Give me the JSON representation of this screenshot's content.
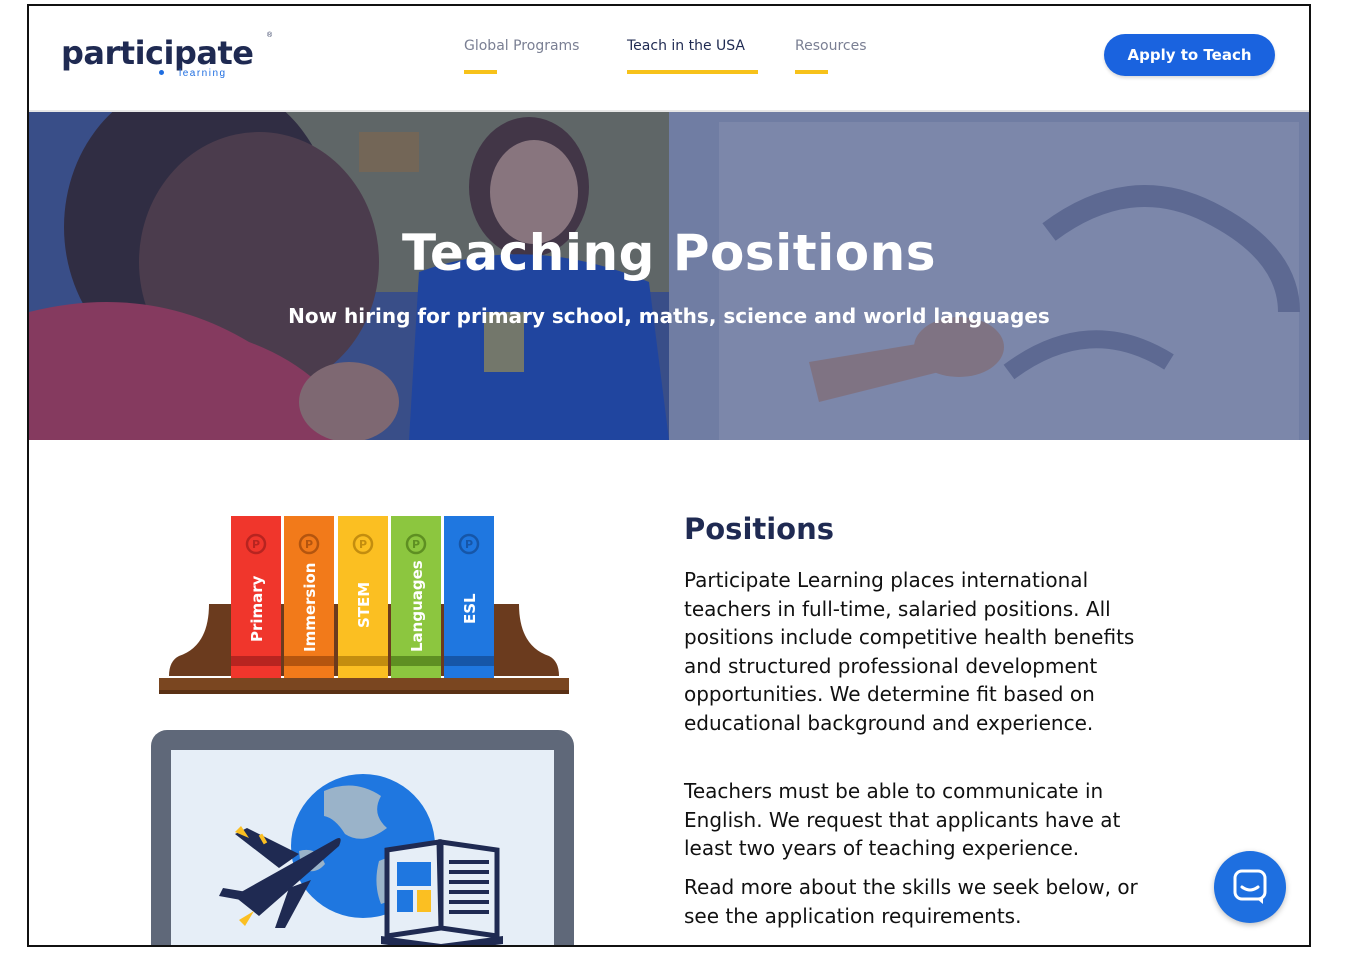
{
  "brand": {
    "name": "participate",
    "tagline": "learning",
    "colors": {
      "navy": "#1f2a52",
      "blue": "#1a63df",
      "accent_yellow": "#f7c21a"
    }
  },
  "nav": {
    "items": [
      {
        "label": "Global Programs",
        "active": false
      },
      {
        "label": "Teach in the USA",
        "active": true
      },
      {
        "label": "Resources",
        "active": false
      }
    ],
    "cta_label": "Apply to Teach"
  },
  "hero": {
    "title": "Teaching Positions",
    "subtitle": "Now hiring for primary school, maths, science and world languages"
  },
  "illustration": {
    "books": [
      {
        "label": "Primary",
        "color": "#f0362c"
      },
      {
        "label": "Immersion",
        "color": "#f27a1a"
      },
      {
        "label": "STEM",
        "color": "#fbbf22"
      },
      {
        "label": "Languages",
        "color": "#8cc63f"
      },
      {
        "label": "ESL",
        "color": "#1f77e0"
      }
    ],
    "book_badge": "P"
  },
  "content": {
    "title": "Positions",
    "paragraphs": [
      "Participate Learning places international teachers in full-time, salaried positions. All positions include competitive health benefits and structured professional development opportunities. We determine fit based on educational background and experience.",
      "Teachers must be able to communicate in English. We request that applicants have at least two years of teaching experience.",
      "Read more about the skills we seek below, or see the application requirements."
    ]
  },
  "widgets": {
    "chat_icon": "chat-bubble-icon"
  }
}
